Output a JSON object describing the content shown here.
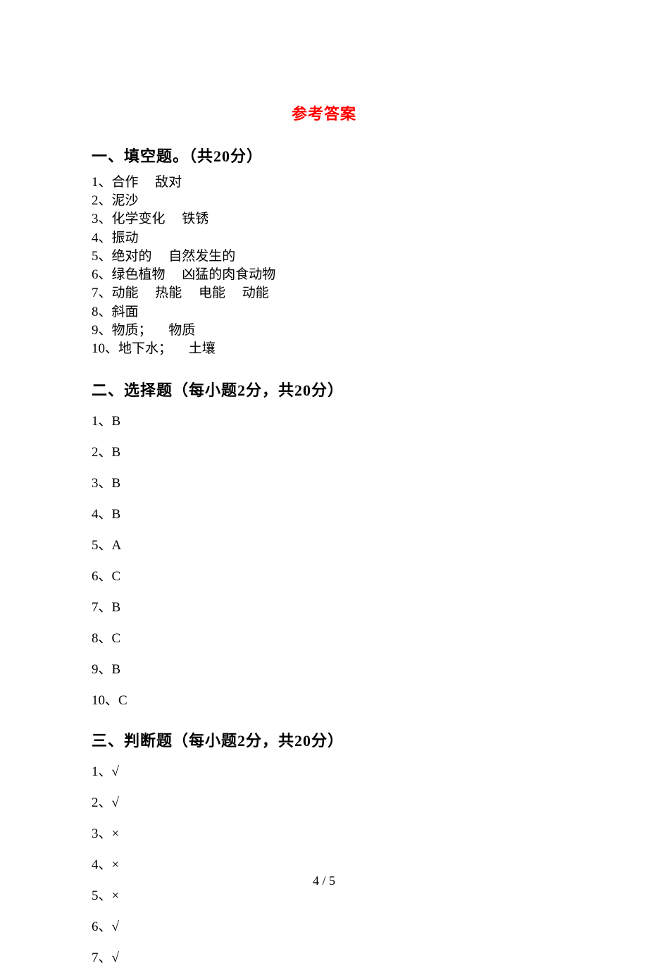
{
  "title": "参考答案",
  "sections": {
    "s1": {
      "header": "一、填空题。（共20分）",
      "items": [
        "1、合作     敌对",
        "2、泥沙",
        "3、化学变化     铁锈",
        "4、振动",
        "5、绝对的     自然发生的",
        "6、绿色植物     凶猛的肉食动物",
        "7、动能     热能     电能     动能",
        "8、斜面",
        "9、物质；     物质",
        "10、地下水；     土壤"
      ]
    },
    "s2": {
      "header": "二、选择题（每小题2分，共20分）",
      "items": [
        "1、B",
        "2、B",
        "3、B",
        "4、B",
        "5、A",
        "6、C",
        "7、B",
        "8、C",
        "9、B",
        "10、C"
      ]
    },
    "s3": {
      "header": "三、判断题（每小题2分，共20分）",
      "items": [
        "1、√",
        "2、√",
        "3、×",
        "4、×",
        "5、×",
        "6、√",
        "7、√"
      ]
    }
  },
  "footer": "4 / 5"
}
